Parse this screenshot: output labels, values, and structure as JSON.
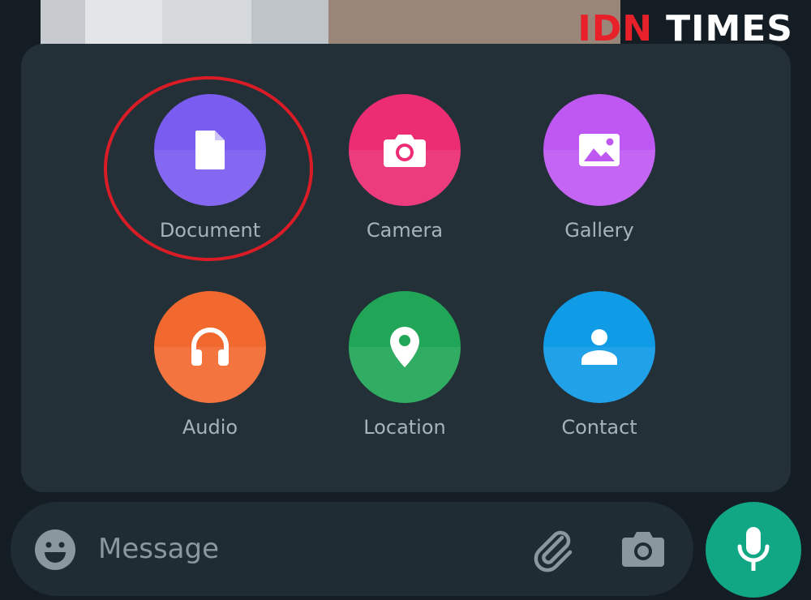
{
  "watermark": {
    "brand_left": "IDN",
    "brand_right": "TIMES"
  },
  "attach_menu": {
    "items": [
      {
        "label": "Document",
        "icon": "document-icon",
        "color": "#7a5cf0"
      },
      {
        "label": "Camera",
        "icon": "camera-icon",
        "color": "#ec2c73"
      },
      {
        "label": "Gallery",
        "icon": "gallery-icon",
        "color": "#bf58f2"
      },
      {
        "label": "Audio",
        "icon": "headphones-icon",
        "color": "#f2692f"
      },
      {
        "label": "Location",
        "icon": "location-pin-icon",
        "color": "#20a656"
      },
      {
        "label": "Contact",
        "icon": "person-icon",
        "color": "#0f9be6"
      }
    ],
    "highlighted": "Document",
    "highlight_color": "#d91c26"
  },
  "composer": {
    "placeholder": "Message",
    "emoji_icon": "emoji-icon",
    "attach_icon": "paperclip-icon",
    "camera_icon": "camera-icon"
  },
  "mic_button": {
    "icon": "microphone-icon",
    "color": "#12a784"
  },
  "colors": {
    "panel_bg": "#233038",
    "composer_bg": "#1f2c34",
    "label_text": "#a7b3bb"
  }
}
